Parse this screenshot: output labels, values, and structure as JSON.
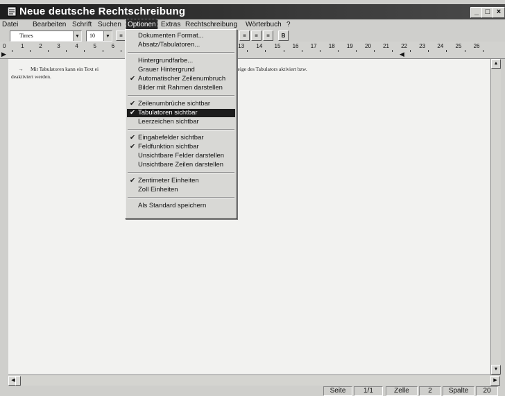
{
  "window": {
    "title": "Neue deutsche Rechtschreibung",
    "caption_buttons": [
      "_",
      "□",
      "×"
    ]
  },
  "menubar": {
    "items": [
      "Datei",
      "Bearbeiten",
      "Schrift",
      "Suchen",
      "Optionen",
      "Extras",
      "Rechtschreibung",
      "Wörterbuch",
      "?"
    ],
    "active": "Optionen"
  },
  "toolbar": {
    "font": "Times",
    "size": "10",
    "buttons": [
      "≡",
      "≡",
      "≡",
      "≡",
      "B"
    ]
  },
  "ruler": {
    "numbers": [
      "0",
      "1",
      "2",
      "3",
      "4",
      "5",
      "6",
      "7",
      "8",
      "9",
      "10",
      "11",
      "12",
      "13",
      "14",
      "15",
      "16",
      "17",
      "18",
      "19",
      "20",
      "21",
      "22",
      "23",
      "24",
      "25",
      "26"
    ]
  },
  "document": {
    "text_line1_left": "Mit Tabulatoren kann ein Text ei",
    "text_line1_right": "nn die Anzeige des Tabulators aktiviert bzw.",
    "text_line2": "deaktiviert werden."
  },
  "options_menu": {
    "items": [
      {
        "label": "Dokumenten Format...",
        "checked": false
      },
      {
        "label": "Absatz/Tabulatoren...",
        "checked": false
      },
      {
        "label": "Hintergrundfarbe...",
        "checked": false
      },
      {
        "label": "Grauer Hintergrund",
        "checked": false
      },
      {
        "label": "Automatischer Zeilenumbruch",
        "checked": true
      },
      {
        "label": "Bilder mit Rahmen darstellen",
        "checked": false
      },
      {
        "label": "Zeilenumbrüche sichtbar",
        "checked": true
      },
      {
        "label": "Tabulatoren sichtbar",
        "checked": true,
        "selected": true
      },
      {
        "label": "Leerzeichen sichtbar",
        "checked": false
      },
      {
        "label": "Eingabefelder sichtbar",
        "checked": true
      },
      {
        "label": "Feldfunktion sichtbar",
        "checked": true
      },
      {
        "label": "Unsichtbare Felder darstellen",
        "checked": false
      },
      {
        "label": "Unsichtbare Zeilen darstellen",
        "checked": false
      },
      {
        "label": "Zentimeter Einheiten",
        "checked": true
      },
      {
        "label": "Zoll Einheiten",
        "checked": false
      },
      {
        "label": "Als Standard speichern",
        "checked": false
      }
    ],
    "check_glyph": "✔"
  },
  "statusbar": {
    "page_label": "Seite",
    "page_value": "1/1",
    "line_label": "Zelle",
    "line_value": "2",
    "column_label": "Spalte",
    "column_value": "20"
  }
}
